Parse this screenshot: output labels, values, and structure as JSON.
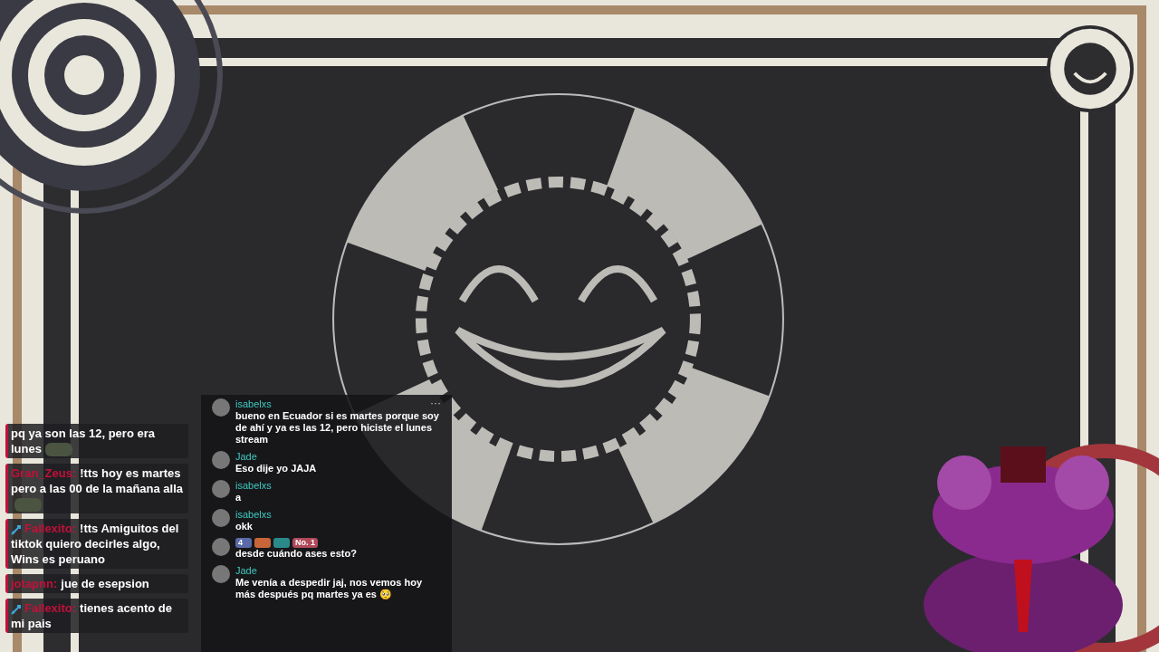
{
  "stream_chat": [
    {
      "color": "#c2103a",
      "verified": false,
      "text": "pq ya son las 12, pero era lunes",
      "emote": true
    },
    {
      "user": "Gran_Zeus:",
      "color": "#c2103a",
      "verified": false,
      "text": "!tts hoy es martes pero a las 00 de la mañana alla",
      "emote": true
    },
    {
      "user": "Fallexito:",
      "color": "#c2103a",
      "verified": true,
      "text": "!tts Amiguitos del tiktok quiero decirles algo, Wins es peruano",
      "emote": false
    },
    {
      "user": "jotapnn:",
      "color": "#c2103a",
      "verified": false,
      "text": "jue de esepsion",
      "emote": false
    },
    {
      "user": "Fallexito:",
      "color": "#c2103a",
      "verified": true,
      "text": "tienes acento de mi pais",
      "emote": false
    }
  ],
  "tiktok_chat": {
    "menu": "···",
    "messages": [
      {
        "user": "isabelxs",
        "text": "bueno en Ecuador si es martes porque soy de ahí y ya es las 12, pero hiciste el lunes stream"
      },
      {
        "user": "Jade",
        "text": "Eso dije yo JAJA"
      },
      {
        "user": "isabelxs",
        "text": "a"
      },
      {
        "user": "isabelxs",
        "text": "okk"
      },
      {
        "text": "desde cuándo ases esto?",
        "badges": [
          {
            "kind": "level",
            "label": "4"
          },
          {
            "kind": "gift"
          },
          {
            "kind": "team"
          },
          {
            "kind": "rank",
            "label": "No. 1"
          }
        ]
      },
      {
        "user": "Jade",
        "text": "Me venía a despedir jaj, nos vemos hoy más después pq martes ya es 🥺"
      }
    ]
  }
}
